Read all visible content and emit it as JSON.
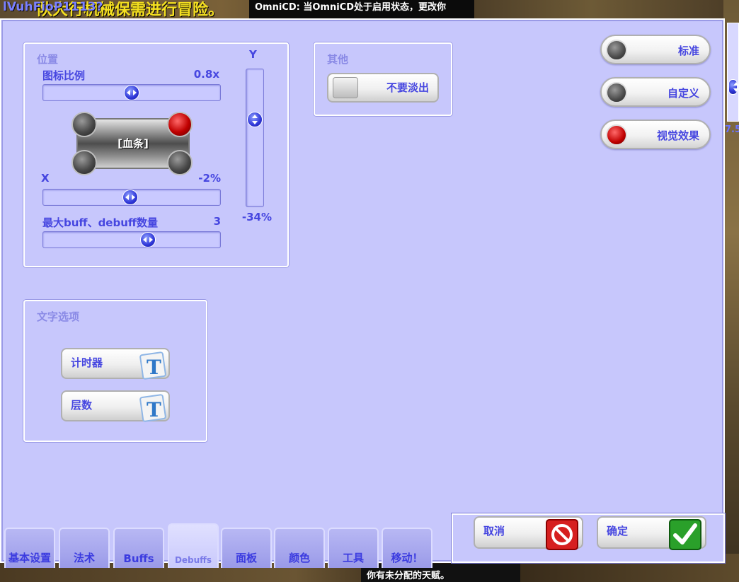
{
  "background": {
    "top_banner": "队大行机械保需进行冒险。",
    "top_banner_overlay": "lVuhFioP1113?",
    "omnicd_notice": "OmniCD: 当OmniCD处于启用状态，更改你",
    "bottom_message": "你有未分配的天赋。",
    "right_value": "7.5"
  },
  "position_group": {
    "title": "位置",
    "icon_scale_label": "图标比例",
    "icon_scale_value": "0.8x",
    "icon_scale_level": 0.5,
    "preview_label": "[血条]",
    "x_label": "X",
    "x_value": "-2%",
    "x_level": 0.49,
    "y_label": "Y",
    "y_value": "-34%",
    "y_level": 0.35,
    "max_buffs_label": "最大buff、debuff数量",
    "max_buffs_value": "3",
    "max_buffs_level": 0.6
  },
  "other_group": {
    "title": "其他",
    "no_fade_label": "不要淡出",
    "no_fade_checked": false
  },
  "presets": [
    {
      "label": "标准",
      "color": "gray"
    },
    {
      "label": "自定义",
      "color": "gray"
    },
    {
      "label": "视觉效果",
      "color": "red"
    }
  ],
  "text_group": {
    "title": "文字选项",
    "timer_label": "计时器",
    "stacks_label": "层数"
  },
  "actions": {
    "cancel_label": "取消",
    "confirm_label": "确定"
  },
  "tabs": [
    {
      "label": "基本设置"
    },
    {
      "label": "法术"
    },
    {
      "label": "Buffs"
    },
    {
      "label": "Debuffs",
      "active": true
    },
    {
      "label": "面板"
    },
    {
      "label": "颜色"
    },
    {
      "label": "工具"
    },
    {
      "label": "移动！"
    }
  ],
  "colors": {
    "panel_bg": "#c7c7fc",
    "label_blue": "#4646e0",
    "title_lavender": "#8a8ae6",
    "knob_blue": "#2e36d8",
    "red_orb": "#c00000"
  }
}
